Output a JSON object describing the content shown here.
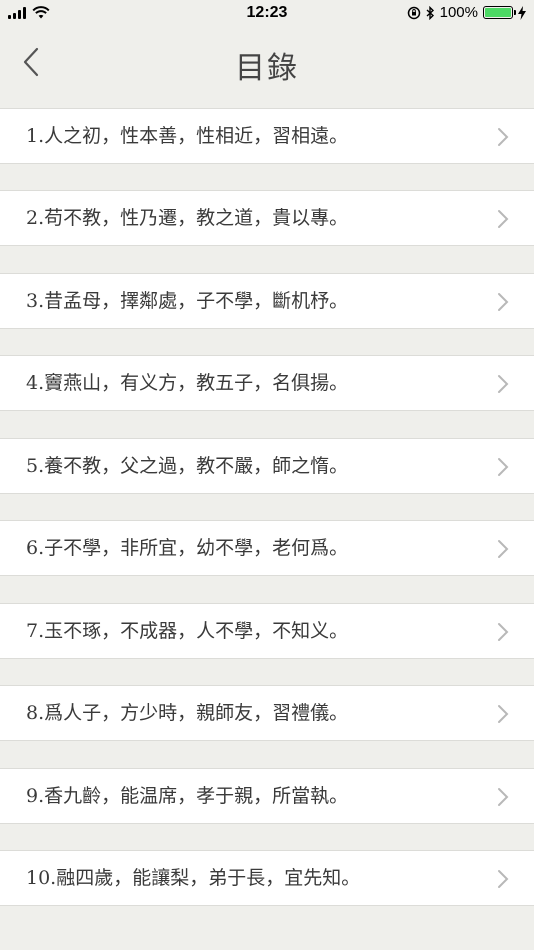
{
  "status_bar": {
    "time": "12:23",
    "battery": "100%",
    "battery_level": 1.0,
    "battery_color": "#4cd964"
  },
  "nav": {
    "title": "目錄",
    "back_icon": "chevron-left-icon"
  },
  "items": [
    {
      "label": "1.人之初，性本善，性相近，習相遠。"
    },
    {
      "label": "2.苟不教，性乃遷，教之道，貴以專。"
    },
    {
      "label": "3.昔孟母，擇鄰處，子不學，斷机杼。"
    },
    {
      "label": "4.竇燕山，有义方，教五子，名俱揚。"
    },
    {
      "label": "5.養不教，父之過，教不嚴，師之惰。"
    },
    {
      "label": "6.子不學，非所宜，幼不學，老何爲。"
    },
    {
      "label": "7.玉不琢，不成器，人不學，不知义。"
    },
    {
      "label": "8.爲人子，方少時，親師友，習禮儀。"
    },
    {
      "label": "9.香九齡，能温席，孝于親，所當執。"
    },
    {
      "label": "10.融四歲，能讓梨，弟于長，宜先知。"
    }
  ],
  "colors": {
    "background": "#efefeb",
    "row_background": "#ffffff",
    "chevron": "#b8b8b8"
  }
}
